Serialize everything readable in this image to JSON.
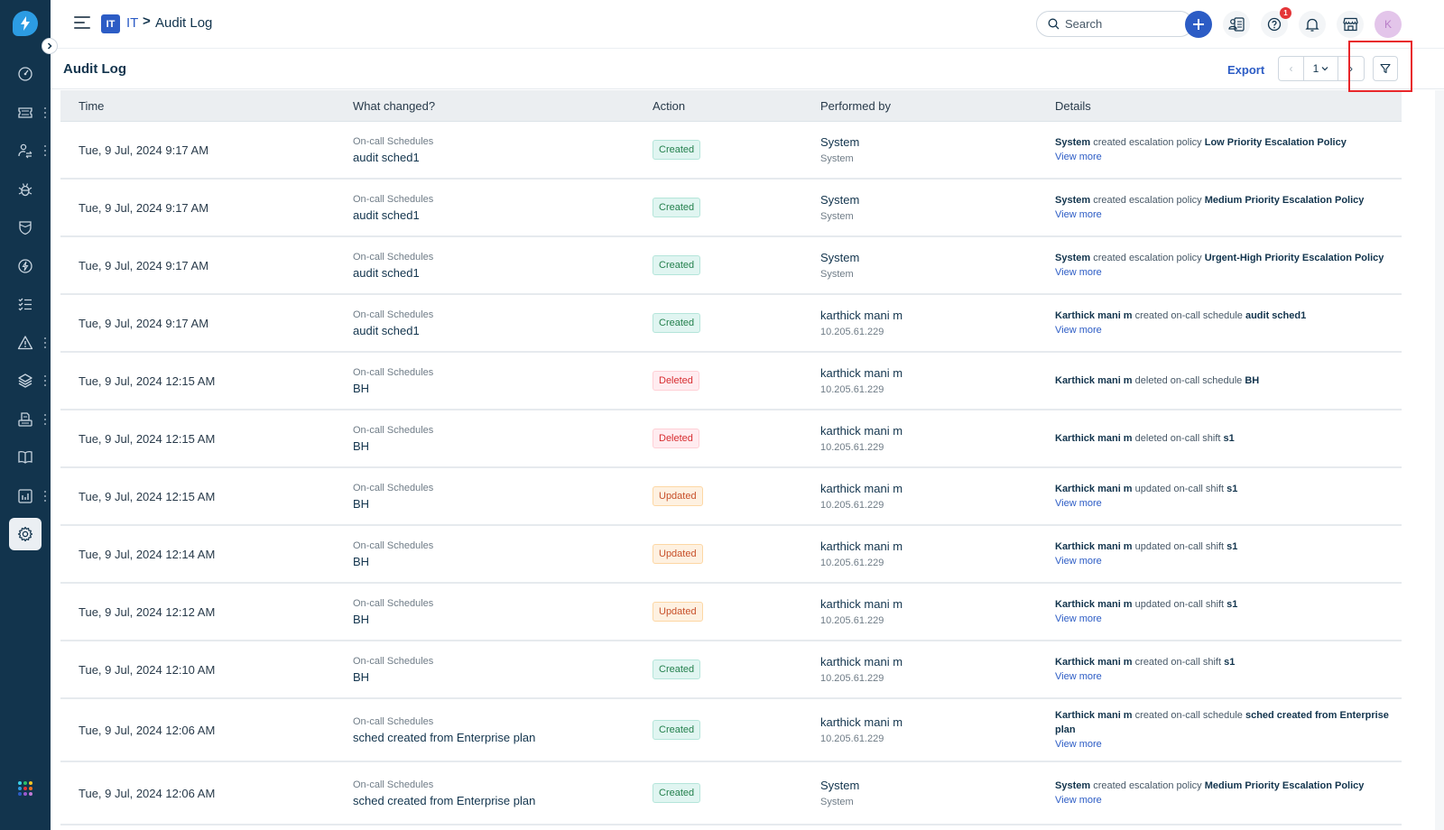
{
  "app": {
    "colors": {
      "sidebar_bg": "#12344d",
      "brand_blue": "#2c5cc5",
      "logo_blue": "#2c9ce3",
      "highlight_red": "#e8262a",
      "badge_created_bg": "#e0f5f1",
      "badge_created_border": "#b4e5da",
      "badge_created_text": "#24804d",
      "badge_deleted_bg": "#ffecf0",
      "badge_deleted_border": "#ffd0d6",
      "badge_deleted_text": "#d72d30",
      "badge_updated_bg": "#fef1e1",
      "badge_updated_border": "#fdd7a4",
      "badge_updated_text": "#c7502a"
    }
  },
  "sidebar": {
    "logo_icon": "lightning-bolt-logo",
    "items": [
      {
        "name": "dashboard",
        "icon": "speedometer-icon",
        "has_menu": false
      },
      {
        "name": "tickets",
        "icon": "ticket-icon",
        "has_menu": true
      },
      {
        "name": "contacts",
        "icon": "user-transfer-icon",
        "has_menu": true
      },
      {
        "name": "problems",
        "icon": "bug-icon",
        "has_menu": false
      },
      {
        "name": "changes",
        "icon": "shield-icon",
        "has_menu": false
      },
      {
        "name": "releases",
        "icon": "bolt-circle-icon",
        "has_menu": false
      },
      {
        "name": "tasks",
        "icon": "checklist-icon",
        "has_menu": false
      },
      {
        "name": "alerts",
        "icon": "warning-icon",
        "has_menu": true
      },
      {
        "name": "assets",
        "icon": "layers-icon",
        "has_menu": true
      },
      {
        "name": "service-catalog",
        "icon": "printer-icon",
        "has_menu": true
      },
      {
        "name": "solutions",
        "icon": "book-icon",
        "has_menu": false
      },
      {
        "name": "analytics",
        "icon": "bar-chart-icon",
        "has_menu": true
      },
      {
        "name": "admin",
        "icon": "gear-icon",
        "has_menu": false,
        "active": true
      }
    ]
  },
  "topbar": {
    "workspace_badge": "IT",
    "breadcrumb_workspace": "IT",
    "breadcrumb_separator": ">",
    "breadcrumb_page": "Audit Log",
    "search_placeholder": "Search",
    "help_badge_count": "1",
    "avatar_initial": "K"
  },
  "page_header": {
    "title": "Audit Log",
    "export_label": "Export",
    "pager_prev": "‹",
    "current_page": "1",
    "pager_next": "›"
  },
  "table": {
    "headers": {
      "time": "Time",
      "what": "What changed?",
      "action": "Action",
      "performed_by": "Performed by",
      "details": "Details"
    },
    "rows": [
      {
        "time": "Tue, 9 Jul, 2024 9:17 AM",
        "category": "On-call Schedules",
        "name": "audit sched1",
        "action": "Created",
        "performer": "System",
        "performer_sub": "System",
        "details": [
          {
            "b": "System"
          },
          {
            "t": " created escalation policy "
          },
          {
            "b": "Low Priority Escalation Policy"
          }
        ],
        "view_more": "View more"
      },
      {
        "time": "Tue, 9 Jul, 2024 9:17 AM",
        "category": "On-call Schedules",
        "name": "audit sched1",
        "action": "Created",
        "performer": "System",
        "performer_sub": "System",
        "details": [
          {
            "b": "System"
          },
          {
            "t": " created escalation policy "
          },
          {
            "b": "Medium Priority Escalation Policy"
          }
        ],
        "view_more": "View more"
      },
      {
        "time": "Tue, 9 Jul, 2024 9:17 AM",
        "category": "On-call Schedules",
        "name": "audit sched1",
        "action": "Created",
        "performer": "System",
        "performer_sub": "System",
        "details": [
          {
            "b": "System"
          },
          {
            "t": " created escalation policy "
          },
          {
            "b": "Urgent-High Priority Escalation Policy"
          }
        ],
        "view_more": "View more"
      },
      {
        "time": "Tue, 9 Jul, 2024 9:17 AM",
        "category": "On-call Schedules",
        "name": "audit sched1",
        "action": "Created",
        "performer": "karthick mani m",
        "performer_sub": "10.205.61.229",
        "details": [
          {
            "b": "Karthick mani m"
          },
          {
            "t": " created on-call schedule "
          },
          {
            "b": "audit sched1"
          }
        ],
        "view_more": "View more"
      },
      {
        "time": "Tue, 9 Jul, 2024 12:15 AM",
        "category": "On-call Schedules",
        "name": "BH",
        "action": "Deleted",
        "performer": "karthick mani m",
        "performer_sub": "10.205.61.229",
        "details": [
          {
            "b": "Karthick mani m"
          },
          {
            "t": " deleted on-call schedule "
          },
          {
            "b": "BH"
          }
        ],
        "view_more": ""
      },
      {
        "time": "Tue, 9 Jul, 2024 12:15 AM",
        "category": "On-call Schedules",
        "name": "BH",
        "action": "Deleted",
        "performer": "karthick mani m",
        "performer_sub": "10.205.61.229",
        "details": [
          {
            "b": "Karthick mani m"
          },
          {
            "t": " deleted on-call shift "
          },
          {
            "b": "s1"
          }
        ],
        "view_more": ""
      },
      {
        "time": "Tue, 9 Jul, 2024 12:15 AM",
        "category": "On-call Schedules",
        "name": "BH",
        "action": "Updated",
        "performer": "karthick mani m",
        "performer_sub": "10.205.61.229",
        "details": [
          {
            "b": "Karthick mani m"
          },
          {
            "t": " updated on-call shift "
          },
          {
            "b": "s1"
          }
        ],
        "view_more": "View more"
      },
      {
        "time": "Tue, 9 Jul, 2024 12:14 AM",
        "category": "On-call Schedules",
        "name": "BH",
        "action": "Updated",
        "performer": "karthick mani m",
        "performer_sub": "10.205.61.229",
        "details": [
          {
            "b": "Karthick mani m"
          },
          {
            "t": " updated on-call shift "
          },
          {
            "b": "s1"
          }
        ],
        "view_more": "View more"
      },
      {
        "time": "Tue, 9 Jul, 2024 12:12 AM",
        "category": "On-call Schedules",
        "name": "BH",
        "action": "Updated",
        "performer": "karthick mani m",
        "performer_sub": "10.205.61.229",
        "details": [
          {
            "b": "Karthick mani m"
          },
          {
            "t": " updated on-call shift "
          },
          {
            "b": "s1"
          }
        ],
        "view_more": "View more"
      },
      {
        "time": "Tue, 9 Jul, 2024 12:10 AM",
        "category": "On-call Schedules",
        "name": "BH",
        "action": "Created",
        "performer": "karthick mani m",
        "performer_sub": "10.205.61.229",
        "details": [
          {
            "b": "Karthick mani m"
          },
          {
            "t": " created on-call shift "
          },
          {
            "b": "s1"
          }
        ],
        "view_more": "View more"
      },
      {
        "time": "Tue, 9 Jul, 2024 12:06 AM",
        "category": "On-call Schedules",
        "name": "sched created from Enterprise plan",
        "action": "Created",
        "performer": "karthick mani m",
        "performer_sub": "10.205.61.229",
        "details": [
          {
            "b": "Karthick mani m"
          },
          {
            "t": " created on-call schedule "
          },
          {
            "b": "sched created from Enterprise plan"
          }
        ],
        "view_more": "View more"
      },
      {
        "time": "Tue, 9 Jul, 2024 12:06 AM",
        "category": "On-call Schedules",
        "name": "sched created from Enterprise plan",
        "action": "Created",
        "performer": "System",
        "performer_sub": "System",
        "details": [
          {
            "b": "System"
          },
          {
            "t": " created escalation policy "
          },
          {
            "b": "Medium Priority Escalation Policy"
          }
        ],
        "view_more": "View more"
      }
    ]
  }
}
